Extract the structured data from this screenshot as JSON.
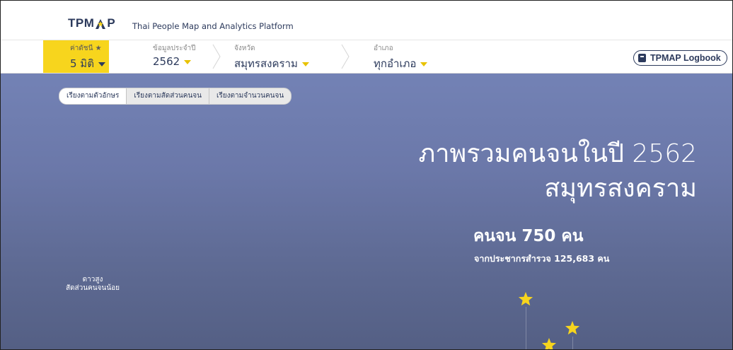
{
  "header": {
    "logo": "TPMAP",
    "tagline": "Thai People Map and Analytics Platform"
  },
  "filters": {
    "index": {
      "label": "ค่าดัชนี ★",
      "value": "5 มิติ"
    },
    "year": {
      "label": "ข้อมูลประจำปี",
      "value": "2562"
    },
    "province": {
      "label": "จังหวัด",
      "value": "สมุทรสงคราม"
    },
    "district": {
      "label": "อำเภอ",
      "value": "ทุกอำเภอ"
    }
  },
  "logbook": {
    "label": "TPMAP Logbook"
  },
  "sort": {
    "options": [
      "เรียงตามตัวอักษร",
      "เรียงตามสัดส่วนคนจน",
      "เรียงตามจำนวนคนจน"
    ],
    "active": 0
  },
  "summary": {
    "title_line1": "ภาพรวมคนจนในปี 2562",
    "title_line2": "สมุทรสงคราม",
    "poor_count": "คนจน 750 คน",
    "population": "จากประชากรสำรวจ 125,683 คน"
  },
  "legend": {
    "line1": "ดาวสูง",
    "line2": "สัดส่วนคนจนน้อย"
  },
  "colors": {
    "accent": "#f7d51d",
    "navy": "#2c3a5c",
    "panel_top": "#7382b5",
    "panel_bottom": "#545f84"
  }
}
